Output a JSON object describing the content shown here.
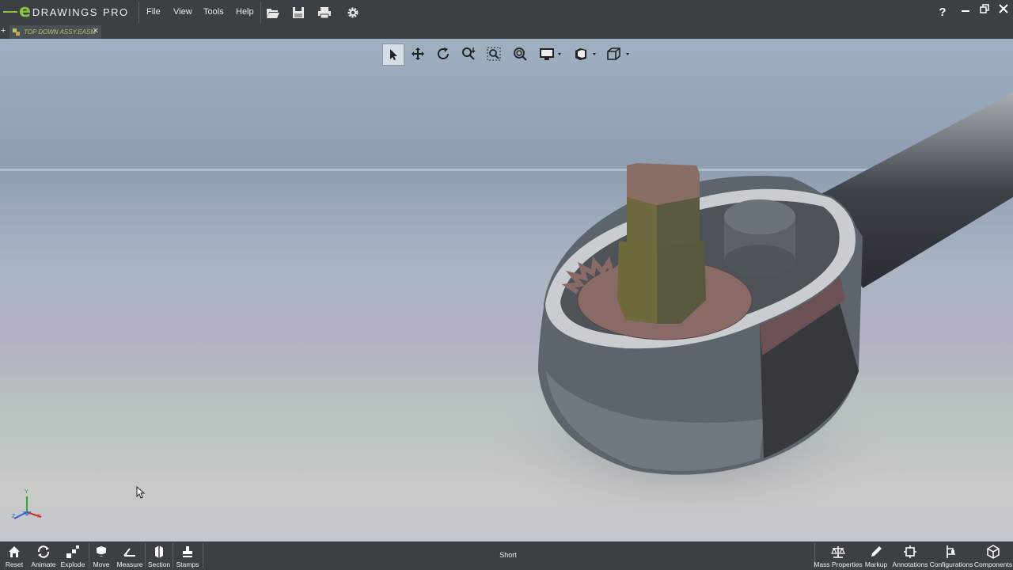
{
  "app": {
    "logo_letter": "e",
    "logo_name": "DRAWINGS",
    "logo_suffix": "PRO",
    "brand_color": "#8fc23c"
  },
  "menu": [
    "File",
    "View",
    "Tools",
    "Help"
  ],
  "toolbar_icons": [
    "open-icon",
    "save-icon",
    "print-icon",
    "settings-icon"
  ],
  "window_controls": [
    "help-icon",
    "minimize-icon",
    "restore-icon",
    "close-icon"
  ],
  "tab": {
    "label": "TOP DOWN ASSY.EASM",
    "close": "✕"
  },
  "view_toolbar": [
    "select-icon",
    "pan-icon",
    "rotate-icon",
    "zoom-icon",
    "zoom-to-area-icon",
    "zoom-to-fit-icon",
    "display-style-icon",
    "view-orientation-icon",
    "standard-views-icon"
  ],
  "triad_axes": {
    "y": "Y",
    "x": "X",
    "z": "Z"
  },
  "bottom_left": [
    {
      "label": "Reset",
      "icon": "home-icon"
    },
    {
      "label": "Animate",
      "icon": "animate-icon"
    },
    {
      "label": "Explode",
      "icon": "explode-icon"
    },
    {
      "label": "Move",
      "icon": "move-icon"
    },
    {
      "label": "Measure",
      "icon": "measure-icon"
    },
    {
      "label": "Section",
      "icon": "section-icon"
    },
    {
      "label": "Stamps",
      "icon": "stamps-icon"
    }
  ],
  "status_text": "Short",
  "bottom_right": [
    {
      "label": "Mass Properties",
      "icon": "scale-icon"
    },
    {
      "label": "Markup",
      "icon": "pencil-icon"
    },
    {
      "label": "Annotations",
      "icon": "annotations-icon"
    },
    {
      "label": "Configurations",
      "icon": "configurations-icon"
    },
    {
      "label": "Components",
      "icon": "components-icon"
    }
  ]
}
